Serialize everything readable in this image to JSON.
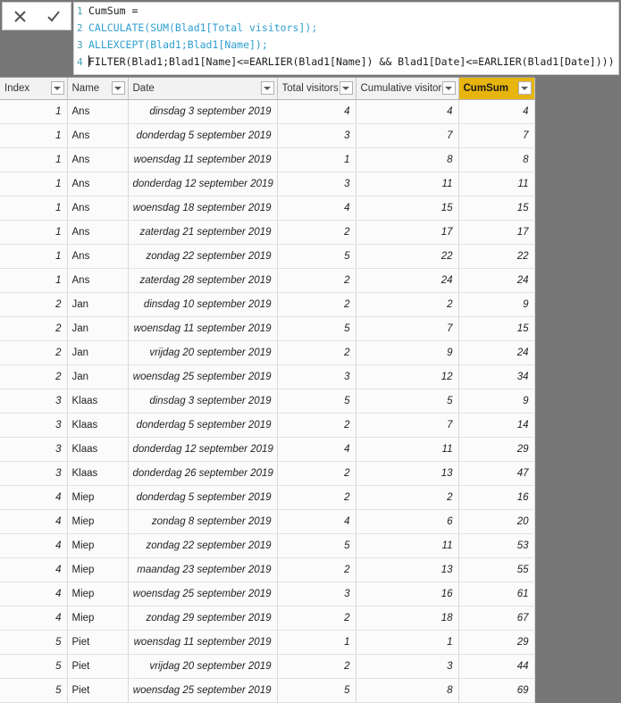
{
  "formula_bar": {
    "cancel_label": "Cancel",
    "commit_label": "Commit",
    "lines": [
      {
        "num": "1",
        "text": "CumSum ="
      },
      {
        "num": "2",
        "text": "CALCULATE(SUM(Blad1[Total visitors]);"
      },
      {
        "num": "3",
        "text": "ALLEXCEPT(Blad1;Blad1[Name]);"
      },
      {
        "num": "4",
        "text": "FILTER(Blad1;Blad1[Name]<=EARLIER(Blad1[Name]) && Blad1[Date]<=EARLIER(Blad1[Date])))"
      }
    ]
  },
  "table": {
    "columns": [
      {
        "label": "Index",
        "selected": false
      },
      {
        "label": "Name",
        "selected": false
      },
      {
        "label": "Date",
        "selected": false
      },
      {
        "label": "Total visitors",
        "selected": false
      },
      {
        "label": "Cumulative visitors",
        "selected": false
      },
      {
        "label": "CumSum",
        "selected": true
      }
    ],
    "rows": [
      [
        "1",
        "Ans",
        "dinsdag 3 september 2019",
        "4",
        "4",
        "4"
      ],
      [
        "1",
        "Ans",
        "donderdag 5 september 2019",
        "3",
        "7",
        "7"
      ],
      [
        "1",
        "Ans",
        "woensdag 11 september 2019",
        "1",
        "8",
        "8"
      ],
      [
        "1",
        "Ans",
        "donderdag 12 september 2019",
        "3",
        "11",
        "11"
      ],
      [
        "1",
        "Ans",
        "woensdag 18 september 2019",
        "4",
        "15",
        "15"
      ],
      [
        "1",
        "Ans",
        "zaterdag 21 september 2019",
        "2",
        "17",
        "17"
      ],
      [
        "1",
        "Ans",
        "zondag 22 september 2019",
        "5",
        "22",
        "22"
      ],
      [
        "1",
        "Ans",
        "zaterdag 28 september 2019",
        "2",
        "24",
        "24"
      ],
      [
        "2",
        "Jan",
        "dinsdag 10 september 2019",
        "2",
        "2",
        "9"
      ],
      [
        "2",
        "Jan",
        "woensdag 11 september 2019",
        "5",
        "7",
        "15"
      ],
      [
        "2",
        "Jan",
        "vrijdag 20 september 2019",
        "2",
        "9",
        "24"
      ],
      [
        "2",
        "Jan",
        "woensdag 25 september 2019",
        "3",
        "12",
        "34"
      ],
      [
        "3",
        "Klaas",
        "dinsdag 3 september 2019",
        "5",
        "5",
        "9"
      ],
      [
        "3",
        "Klaas",
        "donderdag 5 september 2019",
        "2",
        "7",
        "14"
      ],
      [
        "3",
        "Klaas",
        "donderdag 12 september 2019",
        "4",
        "11",
        "29"
      ],
      [
        "3",
        "Klaas",
        "donderdag 26 september 2019",
        "2",
        "13",
        "47"
      ],
      [
        "4",
        "Miep",
        "donderdag 5 september 2019",
        "2",
        "2",
        "16"
      ],
      [
        "4",
        "Miep",
        "zondag 8 september 2019",
        "4",
        "6",
        "20"
      ],
      [
        "4",
        "Miep",
        "zondag 22 september 2019",
        "5",
        "11",
        "53"
      ],
      [
        "4",
        "Miep",
        "maandag 23 september 2019",
        "2",
        "13",
        "55"
      ],
      [
        "4",
        "Miep",
        "woensdag 25 september 2019",
        "3",
        "16",
        "61"
      ],
      [
        "4",
        "Miep",
        "zondag 29 september 2019",
        "2",
        "18",
        "67"
      ],
      [
        "5",
        "Piet",
        "woensdag 11 september 2019",
        "1",
        "1",
        "29"
      ],
      [
        "5",
        "Piet",
        "vrijdag 20 september 2019",
        "2",
        "3",
        "44"
      ],
      [
        "5",
        "Piet",
        "woensdag 25 september 2019",
        "5",
        "8",
        "69"
      ]
    ]
  },
  "colors": {
    "selected_header": "#E8B50E",
    "selected_cell": "#E0E0E0",
    "line_number": "#3F9FB5",
    "function_keyword": "#2E9FD0",
    "page_background": "#777777"
  }
}
